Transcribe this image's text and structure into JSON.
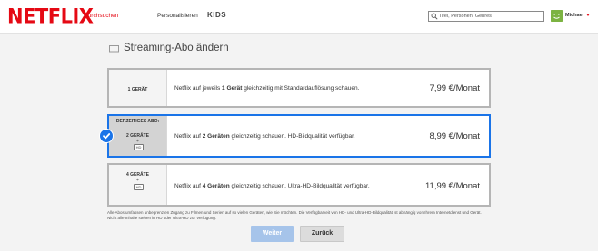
{
  "header": {
    "logo": "NETFLIX",
    "nav": [
      {
        "label": "Durchsuchen",
        "active": true
      },
      {
        "label": "Personalisieren",
        "active": false
      },
      {
        "label": "KIDS",
        "active": false
      }
    ],
    "search": {
      "placeholder": "Titel, Personen, Genres",
      "value": ""
    },
    "profile": {
      "name": "Michael",
      "avatar_color": "#7cb342"
    }
  },
  "page": {
    "title": "Streaming-Abo ändern"
  },
  "plans": [
    {
      "devices_label": "1 GERÄT",
      "desc_prefix": "Netflix auf jeweils ",
      "desc_bold": "1 Gerät",
      "desc_suffix": " gleichzeitig mit Standardauflösung schauen.",
      "price": "7,99 €/Monat",
      "selected": false
    },
    {
      "current_label": "DERZEITIGES ABO:",
      "devices_label": "2 GERÄTE",
      "plus": "+",
      "badge": "HD",
      "desc_prefix": "Netflix auf ",
      "desc_bold": "2 Geräten",
      "desc_suffix": " gleichzeitig schauen. HD-Bildqualität verfügbar.",
      "price": "8,99 €/Monat",
      "selected": true
    },
    {
      "devices_label": "4 GERÄTE",
      "plus": "+",
      "badge": "HD",
      "desc_prefix": "Netflix auf ",
      "desc_bold": "4 Geräten",
      "desc_suffix": " gleichzeitig schauen. Ultra-HD-Bildqualität verfügbar.",
      "price": "11,99 €/Monat",
      "selected": false
    }
  ],
  "footnote": "Alle Abos umfassen unbegrenzten Zugang zu Filmen und Serien auf so vielen Geräten, wie Sie möchten. Die Verfügbarkeit von HD- und Ultra-HD-Bildqualität ist abhängig von Ihrem Internetdienst und Gerät. Nicht alle Inhalte stehen in HD oder Ultra-HD zur Verfügung.",
  "buttons": {
    "next": "Weiter",
    "back": "Zurück"
  },
  "colors": {
    "brand": "#e50914",
    "selected_border": "#1a74e8",
    "next_button": "#a6c4ea"
  }
}
